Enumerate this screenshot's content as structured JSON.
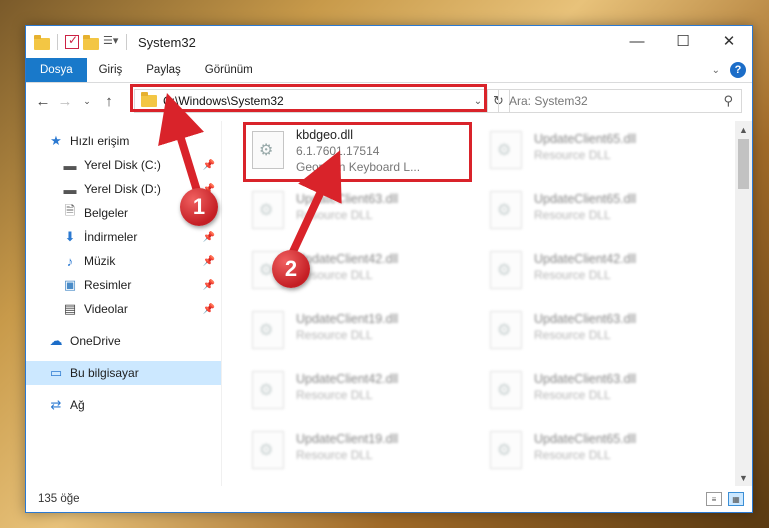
{
  "window": {
    "title": "System32",
    "caption": {
      "minimize": "—",
      "maximize": "☐",
      "close": "✕"
    }
  },
  "ribbon": {
    "tabs": [
      "Dosya",
      "Giriş",
      "Paylaş",
      "Görünüm"
    ],
    "help": "?"
  },
  "nav": {
    "address": "C:\\Windows\\System32",
    "search_placeholder": "Ara: System32"
  },
  "sidebar": {
    "items": [
      {
        "label": "Hızlı erişim",
        "icon": "star-icon",
        "pinned": false
      },
      {
        "label": "Yerel Disk (C:)",
        "icon": "drive-icon",
        "pinned": true
      },
      {
        "label": "Yerel Disk (D:)",
        "icon": "drive-icon",
        "pinned": true
      },
      {
        "label": "Belgeler",
        "icon": "documents-icon",
        "pinned": true
      },
      {
        "label": "İndirmeler",
        "icon": "download-icon",
        "pinned": true
      },
      {
        "label": "Müzik",
        "icon": "music-icon",
        "pinned": true
      },
      {
        "label": "Resimler",
        "icon": "pictures-icon",
        "pinned": true
      },
      {
        "label": "Videolar",
        "icon": "videos-icon",
        "pinned": true
      },
      {
        "label": "OneDrive",
        "icon": "cloud-icon"
      },
      {
        "label": "Bu bilgisayar",
        "icon": "computer-icon",
        "selected": true
      },
      {
        "label": "Ağ",
        "icon": "network-icon"
      }
    ]
  },
  "files": {
    "highlighted": {
      "name": "kbdgeo.dll",
      "version": "6.1.7601.17514",
      "description": "Georgian Keyboard L..."
    },
    "left_column": [
      {
        "name": "UpdateClient63.dll",
        "type": "Resource DLL"
      },
      {
        "name": "UpdateClient42.dll",
        "type": "Resource DLL"
      },
      {
        "name": "UpdateClient19.dll",
        "type": "Resource DLL"
      },
      {
        "name": "UpdateClient42.dll",
        "type": "Resource DLL"
      },
      {
        "name": "UpdateClient19.dll",
        "type": "Resource DLL"
      }
    ],
    "right_column": [
      {
        "name": "UpdateClient65.dll",
        "type": "Resource DLL"
      },
      {
        "name": "UpdateClient65.dll",
        "type": "Resource DLL"
      },
      {
        "name": "UpdateClient42.dll",
        "type": "Resource DLL"
      },
      {
        "name": "UpdateClient63.dll",
        "type": "Resource DLL"
      },
      {
        "name": "UpdateClient63.dll",
        "type": "Resource DLL"
      },
      {
        "name": "UpdateClient65.dll",
        "type": "Resource DLL"
      }
    ]
  },
  "status": {
    "count": "135 öğe"
  },
  "annotations": {
    "badge1": "1",
    "badge2": "2",
    "color": "#d9232a"
  }
}
